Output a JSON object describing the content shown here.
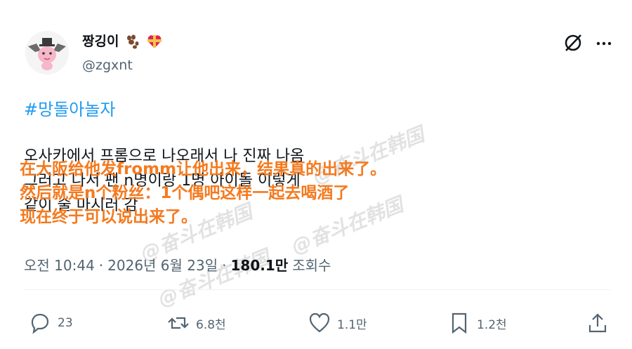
{
  "author": {
    "display_name": "짱깅이",
    "handle": "@zgxnt",
    "avatar_icon": "bat-character-avatar",
    "name_emojis": [
      "paw-prints-icon",
      "heart-ribbon-icon"
    ]
  },
  "hashtag": "#망돌아놀자",
  "post_lines": [
    "오사카에서 프롬으로 나오래서 나 진짜 나옴",
    "그러고 나서 팬 n명이랑 1명 아이돌 이렇게",
    "같이 술 마시러 감"
  ],
  "translation_overlay": [
    "在大阪给他发fromm让他出来，结果真的出来了。",
    "然后就是n个粉丝：1个偶吧这样一起去喝酒了",
    "现在终于可以说出来了。"
  ],
  "watermark_text": "@奋斗在韩国",
  "meta": {
    "time": "오전 10:44",
    "sep1": "·",
    "date": "2026년 6월 23일",
    "sep2": "·",
    "views_count": "180.1만",
    "views_label": "조회수"
  },
  "actions": {
    "reply": "23",
    "repost": "6.8천",
    "like": "1.1만",
    "bookmark": "1.2천"
  },
  "colors": {
    "hashtag": "#1d9bf0",
    "overlay_text": "#f47a1f",
    "secondary_text": "#536471"
  }
}
